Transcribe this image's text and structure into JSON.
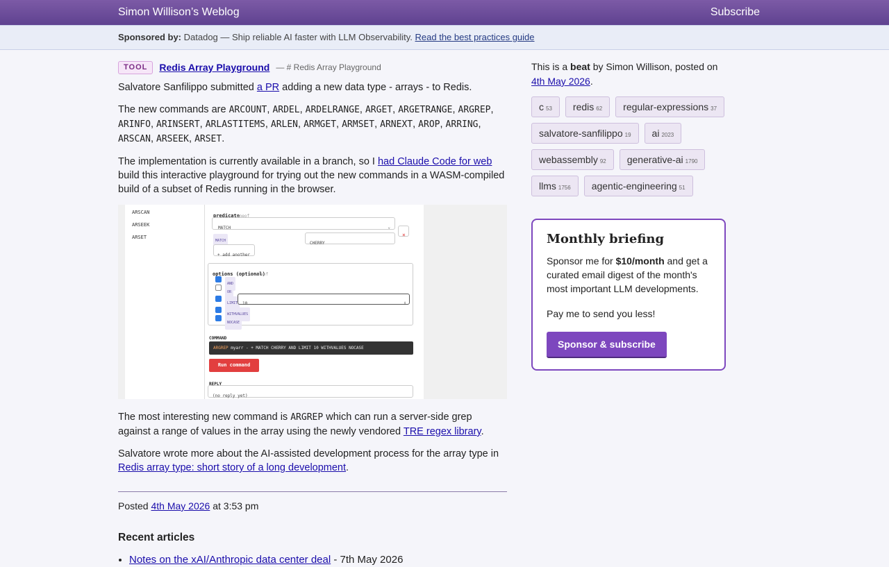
{
  "header": {
    "site_title": "Simon Willison’s Weblog",
    "subscribe_label": "Subscribe"
  },
  "sponsor_bar": {
    "label": "Sponsored by:",
    "text": "Datadog — Ship reliable AI faster with LLM Observability.",
    "link": "Read the best practices guide"
  },
  "entry": {
    "badge": "TOOL",
    "title": "Redis Array Playground",
    "subtitle": "— # Redis Array Playground",
    "p1": {
      "t1": "Salvatore Sanfilippo submitted ",
      "link": "a PR",
      "t2": " adding a new data type - arrays - to Redis."
    },
    "p2_intro": "The new commands are ",
    "commands": [
      "ARCOUNT",
      "ARDEL",
      "ARDELRANGE",
      "ARGET",
      "ARGETRANGE",
      "ARGREP",
      "ARINFO",
      "ARINSERT",
      "ARLASTITEMS",
      "ARLEN",
      "ARMGET",
      "ARMSET",
      "ARNEXT",
      "AROP",
      "ARRING",
      "ARSCAN",
      "ARSEEK",
      "ARSET"
    ],
    "p3": {
      "t1": "The implementation is currently available in a branch, so I ",
      "link": "had Claude Code for web",
      "t2": " build this interactive playground for trying out the new commands in a WASM-compiled build of a subset of Redis running in the browser."
    },
    "screenshot": {
      "left_items": [
        "ARSCAN",
        "ARSEEK",
        "ARSET"
      ],
      "predicate_label": "predicate",
      "predicate_hint": "oneof",
      "select_value": "MATCH",
      "match_chip": "MATCH",
      "match_value": "CHERRY",
      "remove_glyph": "×",
      "add_another": "+ add another",
      "options_label": "options (optional)",
      "options_hint": "oneof",
      "options": [
        {
          "label": "AND",
          "checked": true
        },
        {
          "label": "OR",
          "checked": false
        },
        {
          "label": "LIMIT",
          "checked": true
        },
        {
          "label": "WITHVALUES",
          "checked": true
        },
        {
          "label": "NOCASE",
          "checked": true
        }
      ],
      "limit_value": "10",
      "stepper_glyph": "⇕",
      "command_label": "COMMAND",
      "command_cmd": "ARGREP",
      "command_rest": " myarr - + MATCH CHERRY AND LIMIT 10 WITHVALUES NOCASE",
      "run_label": "Run command",
      "reply_label": "REPLY",
      "reply_value": "(no reply yet)"
    },
    "p4": {
      "t1": "The most interesting new command is ",
      "code": "ARGREP",
      "t2": " which can run a server-side grep against a range of values in the array using the newly vendored ",
      "link": "TRE regex library",
      "t3": "."
    },
    "p5": {
      "t1": "Salvatore wrote more about the AI-assisted development process for the array type in ",
      "link": "Redis array type: short story of a long development",
      "t2": "."
    },
    "posted": {
      "label": "Posted ",
      "date": "4th May 2026",
      "time": " at 3:53 pm"
    }
  },
  "recent": {
    "heading": "Recent articles",
    "items": [
      {
        "title": "Notes on the xAI/Anthropic data center deal",
        "date": " - 7th May 2026"
      }
    ]
  },
  "sidebar": {
    "beat": {
      "t1": "This is a ",
      "bold": "beat",
      "t2": " by Simon Willison, posted on ",
      "date": "4th May 2026",
      "t3": "."
    },
    "tags": [
      {
        "name": "c",
        "count": "53"
      },
      {
        "name": "redis",
        "count": "62"
      },
      {
        "name": "regular-expressions",
        "count": "37"
      },
      {
        "name": "salvatore-sanfilippo",
        "count": "19"
      },
      {
        "name": "ai",
        "count": "2023"
      },
      {
        "name": "webassembly",
        "count": "92"
      },
      {
        "name": "generative-ai",
        "count": "1790"
      },
      {
        "name": "llms",
        "count": "1756"
      },
      {
        "name": "agentic-engineering",
        "count": "51"
      }
    ],
    "briefing": {
      "title": "Monthly briefing",
      "t1": "Sponsor me for ",
      "price": "$10/month",
      "t2": " and get a curated email digest of the month's most important LLM developments.",
      "p2": "Pay me to send you less!",
      "button": "Sponsor & subscribe"
    }
  }
}
